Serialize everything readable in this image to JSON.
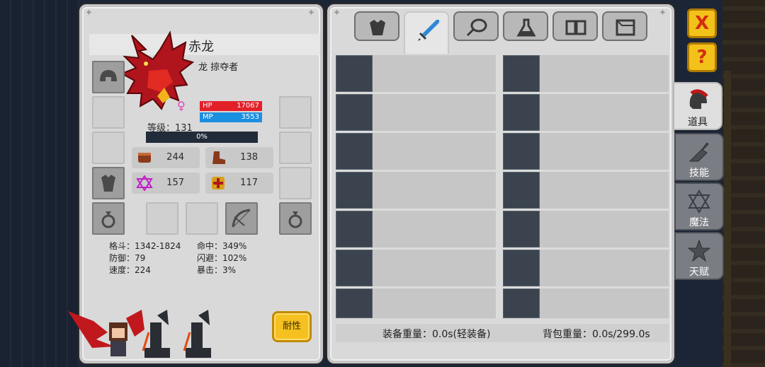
{
  "character": {
    "name": "赤龙",
    "subtitle": "龙 掠夺者",
    "hp_label": "HP",
    "hp_value": "17067",
    "mp_label": "MP",
    "mp_value": "3553",
    "level_text": "等级：131",
    "xp_percent": "0%"
  },
  "stat_boxes": [
    {
      "icon": "fist-icon",
      "value": "244"
    },
    {
      "icon": "boot-icon",
      "value": "138"
    },
    {
      "icon": "hexagram-icon",
      "value": "157"
    },
    {
      "icon": "cross-shield-icon",
      "value": "117"
    }
  ],
  "attributes": {
    "melee": "格斗：1342-1824",
    "defense": "防御：79",
    "speed": "速度：224",
    "accuracy": "命中：349%",
    "evasion": "闪避：102%",
    "crit": "暴击：3%"
  },
  "durability_button": "耐性",
  "weights": {
    "equip": "装备重量：0.0s(轻装备)",
    "bag": "背包重量：0.0s/299.0s"
  },
  "top_tabs": [
    {
      "name": "armor-tab",
      "icon": "armor-icon"
    },
    {
      "name": "weapon-tab",
      "icon": "sword-icon",
      "active": true
    },
    {
      "name": "food-tab",
      "icon": "meat-icon"
    },
    {
      "name": "potion-tab",
      "icon": "flask-icon"
    },
    {
      "name": "book-tab",
      "icon": "book-icon"
    },
    {
      "name": "box-tab",
      "icon": "box-icon"
    }
  ],
  "side_buttons": {
    "close": "X",
    "help": "?"
  },
  "side_tabs": [
    {
      "label": "道具",
      "icon": "helmet-icon",
      "active": true
    },
    {
      "label": "技能",
      "icon": "skill-icon"
    },
    {
      "label": "魔法",
      "icon": "magic-star-icon"
    },
    {
      "label": "天赋",
      "icon": "talent-star-icon"
    }
  ],
  "colors": {
    "hp": "#e2202a",
    "mp": "#1b8fe0",
    "button_yellow": "#f5c020",
    "close_red": "#d42c10"
  }
}
